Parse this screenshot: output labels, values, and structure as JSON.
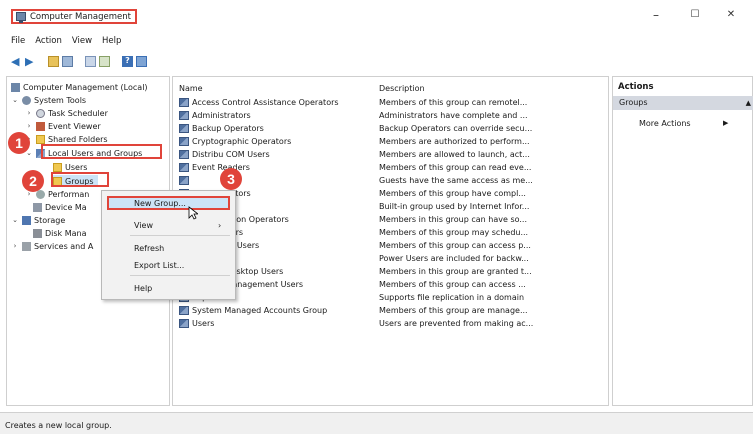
{
  "window": {
    "title": "Computer Management",
    "minimize": "–",
    "maximize": "☐",
    "close": "✕"
  },
  "menu": [
    "File",
    "Action",
    "View",
    "Help"
  ],
  "tree": {
    "root": "Computer Management (Local)",
    "system_tools": "System Tools",
    "task_scheduler": "Task Scheduler",
    "event_viewer": "Event Viewer",
    "shared_folders": "Shared Folders",
    "local_users_groups": "Local Users and Groups",
    "users": "Users",
    "groups": "Groups",
    "performance": "Performan",
    "device_manager": "Device Ma",
    "storage": "Storage",
    "disk_management": "Disk Mana",
    "services": "Services and A"
  },
  "columns": {
    "name": "Name",
    "description": "Description"
  },
  "rows": [
    {
      "name": "Access Control Assistance Operators",
      "desc": "Members of this group can remotel..."
    },
    {
      "name": "Administrators",
      "desc": "Administrators have complete and ..."
    },
    {
      "name": "Backup Operators",
      "desc": "Backup Operators can override secu..."
    },
    {
      "name": "Cryptographic Operators",
      "desc": "Members are authorized to perform..."
    },
    {
      "name": "Distribu    COM Users",
      "desc": "Members are allowed to launch, act..."
    },
    {
      "name": "Event    Readers",
      "desc": "Members of this group can read eve..."
    },
    {
      "name": "",
      "desc": "Guests have the same access as me..."
    },
    {
      "name": "Administrators",
      "desc": "Members of this group have compl..."
    },
    {
      "name": "",
      "desc": "Built-in group used by Internet Infor..."
    },
    {
      "name": "Configuration Operators",
      "desc": "Members in this group can have so..."
    },
    {
      "name": "ce Log Users",
      "desc": "Members of this group may schedu..."
    },
    {
      "name": "ce Monitor Users",
      "desc": "Members of this group can access p..."
    },
    {
      "name": "rs",
      "desc": "Power Users are included for backw..."
    },
    {
      "name": "Remote Desktop Users",
      "desc": "Members in this group are granted t..."
    },
    {
      "name": "Remote Management Users",
      "desc": "Members of this group can access ..."
    },
    {
      "name": "Replicator",
      "desc": "Supports file replication in a domain"
    },
    {
      "name": "System Managed Accounts Group",
      "desc": "Members of this group are manage..."
    },
    {
      "name": "Users",
      "desc": "Users are prevented from making ac..."
    }
  ],
  "actions": {
    "header": "Actions",
    "groups": "Groups",
    "more": "More Actions"
  },
  "context_menu": {
    "new_group": "New Group...",
    "view": "View",
    "refresh": "Refresh",
    "export": "Export List...",
    "help": "Help"
  },
  "badges": [
    "1",
    "2",
    "3"
  ],
  "status": "Creates a new local group."
}
